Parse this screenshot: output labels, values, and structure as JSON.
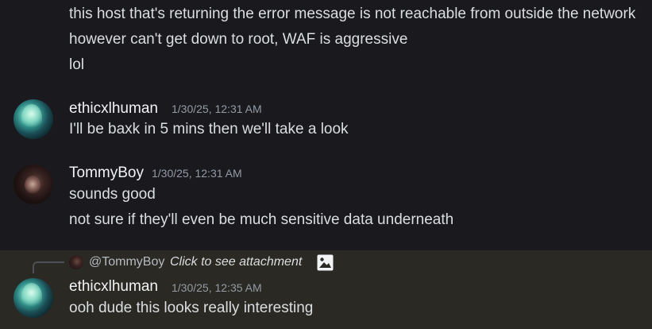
{
  "messages_top": [
    "this host that's returning the error message is not reachable from outside the network",
    "however can't get down to root, WAF is aggressive",
    "lol"
  ],
  "group1": {
    "username": "ethicxlhuman",
    "timestamp": "1/30/25, 12:31 AM",
    "lines": [
      "I'll be baxk in 5 mins then we'll take a look"
    ]
  },
  "group2": {
    "username": "TommyBoy",
    "timestamp": "1/30/25, 12:31 AM",
    "lines": [
      "sounds good",
      "not sure if they'll even be much sensitive data underneath"
    ]
  },
  "group3": {
    "reply": {
      "mention": "@TommyBoy",
      "text": "Click to see attachment",
      "icon": "image-icon"
    },
    "username": "ethicxlhuman",
    "timestamp": "1/30/25, 12:35 AM",
    "lines": [
      "ooh dude this looks really interesting"
    ]
  },
  "colors": {
    "background": "#1a1a1e",
    "highlight": "#2a2923",
    "text": "#dbdee1",
    "muted": "#949ba4"
  }
}
